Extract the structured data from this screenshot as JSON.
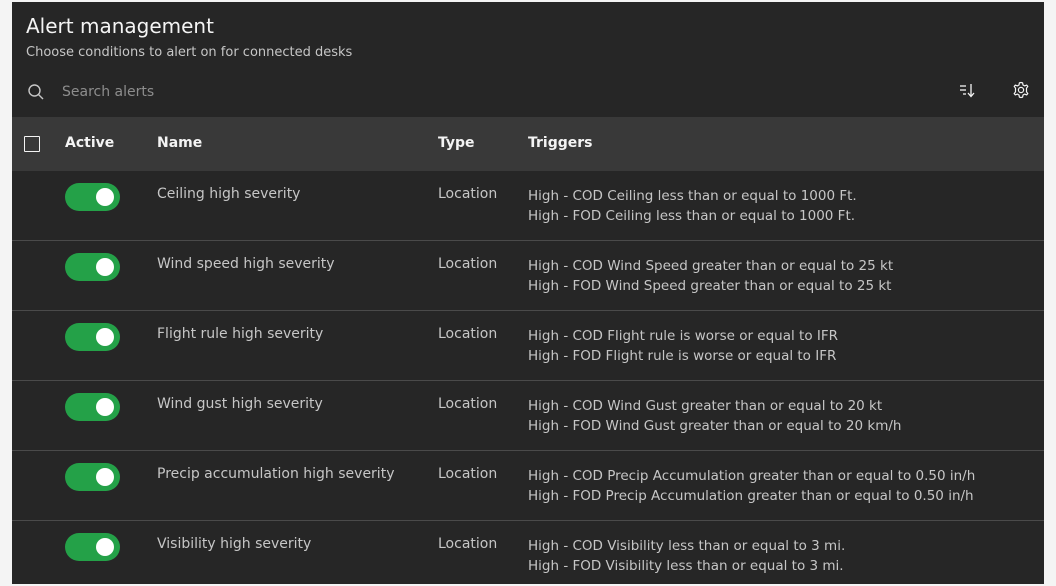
{
  "header": {
    "title": "Alert management",
    "subtitle": "Choose conditions to alert on for connected desks"
  },
  "toolbar": {
    "search_placeholder": "Search alerts",
    "icons": [
      "search-icon",
      "sort-icon",
      "settings-icon"
    ]
  },
  "table": {
    "columns": {
      "active": "Active",
      "name": "Name",
      "type": "Type",
      "triggers": "Triggers"
    },
    "rows": [
      {
        "active": true,
        "name": "Ceiling high severity",
        "type": "Location",
        "triggers": [
          "High - COD Ceiling less than or equal to 1000 Ft.",
          "High - FOD Ceiling less than or equal to 1000 Ft."
        ]
      },
      {
        "active": true,
        "name": "Wind speed high severity",
        "type": "Location",
        "triggers": [
          "High - COD Wind Speed greater than or equal to 25 kt",
          "High - FOD Wind Speed greater than or equal to 25 kt"
        ]
      },
      {
        "active": true,
        "name": "Flight rule high severity",
        "type": "Location",
        "triggers": [
          "High - COD Flight rule is worse or equal to IFR",
          "High - FOD Flight rule is worse or equal to IFR"
        ]
      },
      {
        "active": true,
        "name": "Wind gust high severity",
        "type": "Location",
        "triggers": [
          "High - COD Wind Gust greater than or equal to 20 kt",
          "High - FOD Wind Gust greater than or equal to 20 km/h"
        ]
      },
      {
        "active": true,
        "name": "Precip accumulation high severity",
        "type": "Location",
        "triggers": [
          "High - COD Precip Accumulation greater than or equal to 0.50 in/h",
          "High - FOD Precip Accumulation greater than or equal to 0.50 in/h"
        ]
      },
      {
        "active": true,
        "name": "Visibility high severity",
        "type": "Location",
        "triggers": [
          "High - COD Visibility less than or equal to 3 mi.",
          "High - FOD Visibility less than or equal to 3 mi."
        ]
      }
    ]
  },
  "colors": {
    "panel_bg": "#262626",
    "header_bg": "#393939",
    "toggle_on": "#24a148"
  }
}
